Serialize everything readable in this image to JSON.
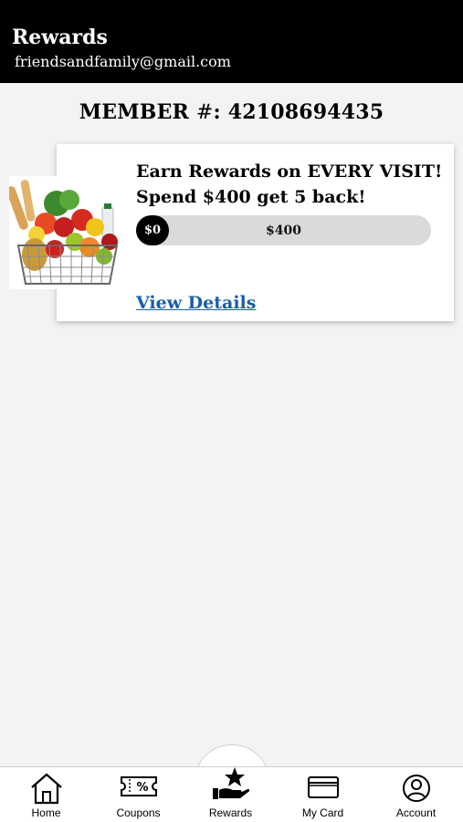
{
  "header": {
    "title": "Rewards",
    "email": "friendsandfamily@gmail.com"
  },
  "member": {
    "label": "MEMBER",
    "hash": "#",
    "number": ": 42108694435"
  },
  "reward_card": {
    "image_name": "grocery-basket",
    "line1": "Earn Rewards on EVERY VISIT!",
    "line2": "Spend $400 get 5 back!",
    "progress": {
      "current_label": "$0",
      "goal_label": "$400",
      "fraction": 0.0
    },
    "details_link": "View Details"
  },
  "tabs": [
    {
      "label": "Home",
      "icon": "home-icon"
    },
    {
      "label": "Coupons",
      "icon": "coupon-icon"
    },
    {
      "label": "Rewards",
      "icon": "rewards-hand-star-icon",
      "active": true
    },
    {
      "label": "My Card",
      "icon": "card-icon"
    },
    {
      "label": "Account",
      "icon": "account-icon"
    }
  ],
  "colors": {
    "header_bg": "#000000",
    "background": "#f3f3f3",
    "link": "#1a5ea8",
    "progress_track": "#dadada"
  }
}
